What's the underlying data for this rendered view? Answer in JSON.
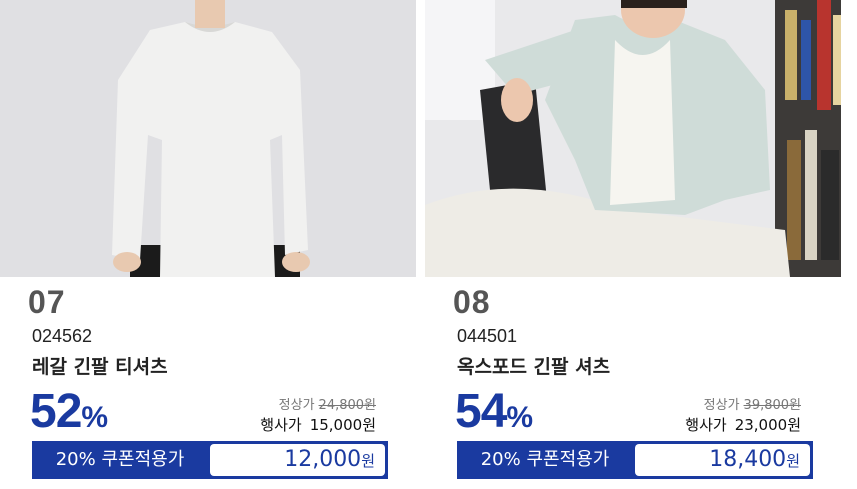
{
  "products": [
    {
      "number": "07",
      "code": "024562",
      "name": "레갈 긴팔 티셔츠",
      "discount": "52",
      "discount_unit": "%",
      "regular_label": "정상가",
      "regular_price": "24,800원",
      "event_label": "행사가",
      "event_price": "15,000원",
      "coupon_label": "20% 쿠폰적용가",
      "coupon_price": "12,000",
      "coupon_unit": "원"
    },
    {
      "number": "08",
      "code": "044501",
      "name": "옥스포드 긴팔 셔츠",
      "discount": "54",
      "discount_unit": "%",
      "regular_label": "정상가",
      "regular_price": "39,800원",
      "event_label": "행사가",
      "event_price": "23,000원",
      "coupon_label": "20% 쿠폰적용가",
      "coupon_price": "18,400",
      "coupon_unit": "원"
    }
  ],
  "colors": {
    "accent": "#1a3aa0",
    "text": "#222222",
    "muted": "#777777"
  }
}
